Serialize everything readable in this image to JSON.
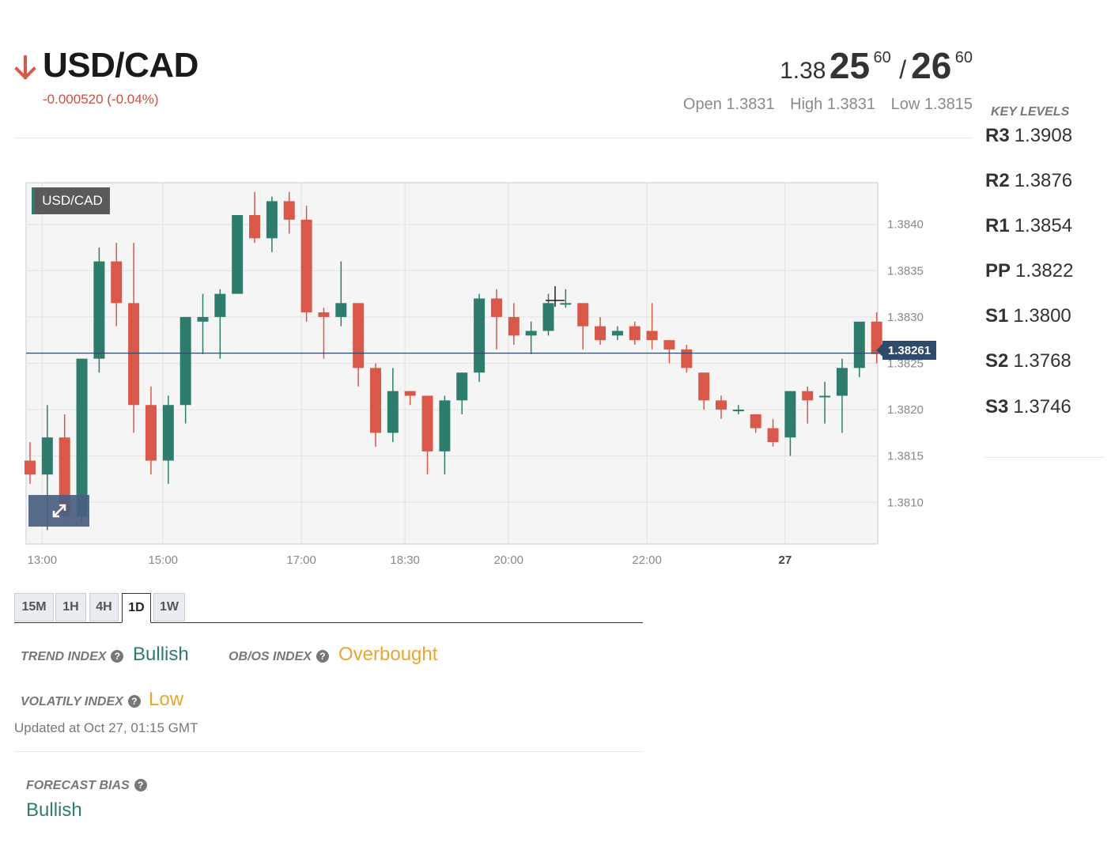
{
  "header": {
    "symbol": "USD/CAD",
    "direction": "down",
    "change": "-0.000520 (-0.04%)",
    "bid_prefix": "1.38",
    "bid_big": "25",
    "bid_pip": "60",
    "separator": "/",
    "ask_big": "26",
    "ask_pip": "60",
    "open": "Open 1.3831",
    "high": "High 1.3831",
    "low": "Low 1.3815"
  },
  "key_levels": {
    "title": "KEY LEVELS",
    "levels": [
      {
        "name": "R3",
        "value": "1.3908"
      },
      {
        "name": "R2",
        "value": "1.3876"
      },
      {
        "name": "R1",
        "value": "1.3854"
      },
      {
        "name": "PP",
        "value": "1.3822"
      },
      {
        "name": "S1",
        "value": "1.3800"
      },
      {
        "name": "S2",
        "value": "1.3768"
      },
      {
        "name": "S3",
        "value": "1.3746"
      }
    ]
  },
  "chart_badge": "USD/CAD",
  "current_price": "1.38261",
  "chart_data": {
    "type": "candlestick",
    "ylim": [
      1.38055,
      1.38445
    ],
    "yticks": [
      1.384,
      1.3835,
      1.383,
      1.3825,
      1.382,
      1.3815,
      1.381
    ],
    "ytick_labels": [
      "1.3840",
      "1.3835",
      "1.3830",
      "1.3825",
      "1.3820",
      "1.3815",
      "1.3810"
    ],
    "xticks": [
      {
        "label": "13:00",
        "index": 0.7,
        "bold": false
      },
      {
        "label": "15:00",
        "index": 7.7,
        "bold": false
      },
      {
        "label": "17:00",
        "index": 15.7,
        "bold": false
      },
      {
        "label": "18:30",
        "index": 21.7,
        "bold": false
      },
      {
        "label": "20:00",
        "index": 27.7,
        "bold": false
      },
      {
        "label": "22:00",
        "index": 35.7,
        "bold": false
      },
      {
        "label": "27",
        "index": 43.7,
        "bold": true
      }
    ],
    "current_price": 1.38261,
    "candles": [
      {
        "o": 1.38145,
        "h": 1.38165,
        "l": 1.3812,
        "c": 1.3813
      },
      {
        "o": 1.3813,
        "h": 1.38205,
        "l": 1.3807,
        "c": 1.3817
      },
      {
        "o": 1.3817,
        "h": 1.38195,
        "l": 1.3808,
        "c": 1.38085
      },
      {
        "o": 1.38085,
        "h": 1.38255,
        "l": 1.3808,
        "c": 1.38255
      },
      {
        "o": 1.38255,
        "h": 1.38375,
        "l": 1.3824,
        "c": 1.3836
      },
      {
        "o": 1.3836,
        "h": 1.3838,
        "l": 1.3829,
        "c": 1.38315
      },
      {
        "o": 1.38315,
        "h": 1.3838,
        "l": 1.38175,
        "c": 1.38205
      },
      {
        "o": 1.38205,
        "h": 1.38225,
        "l": 1.3813,
        "c": 1.38145
      },
      {
        "o": 1.38145,
        "h": 1.38215,
        "l": 1.3812,
        "c": 1.38205
      },
      {
        "o": 1.38205,
        "h": 1.383,
        "l": 1.38185,
        "c": 1.383
      },
      {
        "o": 1.38295,
        "h": 1.38325,
        "l": 1.3826,
        "c": 1.383
      },
      {
        "o": 1.383,
        "h": 1.3833,
        "l": 1.38255,
        "c": 1.38325
      },
      {
        "o": 1.38325,
        "h": 1.3841,
        "l": 1.38325,
        "c": 1.3841
      },
      {
        "o": 1.3841,
        "h": 1.38435,
        "l": 1.3838,
        "c": 1.38385
      },
      {
        "o": 1.38385,
        "h": 1.3843,
        "l": 1.3837,
        "c": 1.38425
      },
      {
        "o": 1.38425,
        "h": 1.38435,
        "l": 1.3839,
        "c": 1.38405
      },
      {
        "o": 1.38405,
        "h": 1.3842,
        "l": 1.38295,
        "c": 1.38305
      },
      {
        "o": 1.38305,
        "h": 1.3831,
        "l": 1.38255,
        "c": 1.383
      },
      {
        "o": 1.383,
        "h": 1.3836,
        "l": 1.3829,
        "c": 1.38315
      },
      {
        "o": 1.38315,
        "h": 1.38315,
        "l": 1.38225,
        "c": 1.38245
      },
      {
        "o": 1.38245,
        "h": 1.3825,
        "l": 1.3816,
        "c": 1.38175
      },
      {
        "o": 1.38175,
        "h": 1.38245,
        "l": 1.38165,
        "c": 1.3822
      },
      {
        "o": 1.3822,
        "h": 1.3822,
        "l": 1.38205,
        "c": 1.38215
      },
      {
        "o": 1.38215,
        "h": 1.38215,
        "l": 1.3813,
        "c": 1.38155
      },
      {
        "o": 1.38155,
        "h": 1.38215,
        "l": 1.3813,
        "c": 1.3821
      },
      {
        "o": 1.3821,
        "h": 1.3824,
        "l": 1.38195,
        "c": 1.3824
      },
      {
        "o": 1.3824,
        "h": 1.38325,
        "l": 1.3823,
        "c": 1.3832
      },
      {
        "o": 1.3832,
        "h": 1.3833,
        "l": 1.38265,
        "c": 1.383
      },
      {
        "o": 1.383,
        "h": 1.38315,
        "l": 1.3827,
        "c": 1.3828
      },
      {
        "o": 1.3828,
        "h": 1.38295,
        "l": 1.3826,
        "c": 1.38285
      },
      {
        "o": 1.38285,
        "h": 1.38325,
        "l": 1.3828,
        "c": 1.38315
      },
      {
        "o": 1.38315,
        "h": 1.3833,
        "l": 1.3831,
        "c": 1.38315
      },
      {
        "o": 1.38315,
        "h": 1.38315,
        "l": 1.38265,
        "c": 1.3829
      },
      {
        "o": 1.3829,
        "h": 1.383,
        "l": 1.3827,
        "c": 1.38275
      },
      {
        "o": 1.3828,
        "h": 1.3829,
        "l": 1.38275,
        "c": 1.38285
      },
      {
        "o": 1.3829,
        "h": 1.38295,
        "l": 1.3827,
        "c": 1.38275
      },
      {
        "o": 1.38285,
        "h": 1.38315,
        "l": 1.38265,
        "c": 1.38275
      },
      {
        "o": 1.38275,
        "h": 1.38275,
        "l": 1.3825,
        "c": 1.38265
      },
      {
        "o": 1.38265,
        "h": 1.3827,
        "l": 1.3824,
        "c": 1.38245
      },
      {
        "o": 1.3824,
        "h": 1.3824,
        "l": 1.382,
        "c": 1.3821
      },
      {
        "o": 1.3821,
        "h": 1.38215,
        "l": 1.3819,
        "c": 1.382
      },
      {
        "o": 1.382,
        "h": 1.38205,
        "l": 1.38195,
        "c": 1.382
      },
      {
        "o": 1.38195,
        "h": 1.38195,
        "l": 1.38175,
        "c": 1.3818
      },
      {
        "o": 1.3818,
        "h": 1.3819,
        "l": 1.3816,
        "c": 1.38165
      },
      {
        "o": 1.3817,
        "h": 1.3822,
        "l": 1.3815,
        "c": 1.3822
      },
      {
        "o": 1.3822,
        "h": 1.38225,
        "l": 1.38185,
        "c": 1.3821
      },
      {
        "o": 1.38215,
        "h": 1.3823,
        "l": 1.38185,
        "c": 1.38215
      },
      {
        "o": 1.38215,
        "h": 1.38255,
        "l": 1.38175,
        "c": 1.38245
      },
      {
        "o": 1.38245,
        "h": 1.38295,
        "l": 1.38235,
        "c": 1.38295
      },
      {
        "o": 1.38295,
        "h": 1.38305,
        "l": 1.3825,
        "c": 1.3826
      }
    ]
  },
  "timeframes": {
    "tabs": [
      "15M",
      "1H",
      "4H",
      "1D",
      "1W"
    ],
    "active": "1D"
  },
  "indexes": {
    "trend_label": "TREND INDEX",
    "trend_value": "Bullish",
    "obos_label": "OB/OS INDEX",
    "obos_value": "Overbought",
    "volatility_label": "VOLATILY INDEX",
    "volatility_value": "Low",
    "updated": "Updated at Oct 27, 01:15 GMT"
  },
  "forecast": {
    "label": "FORECAST BIAS",
    "value": "Bullish"
  },
  "colors": {
    "up": "#2e7d6c",
    "down": "#d9584a",
    "negative_change": "#c9503f",
    "bullish": "#2e7d6c",
    "warning": "#e9a630"
  }
}
